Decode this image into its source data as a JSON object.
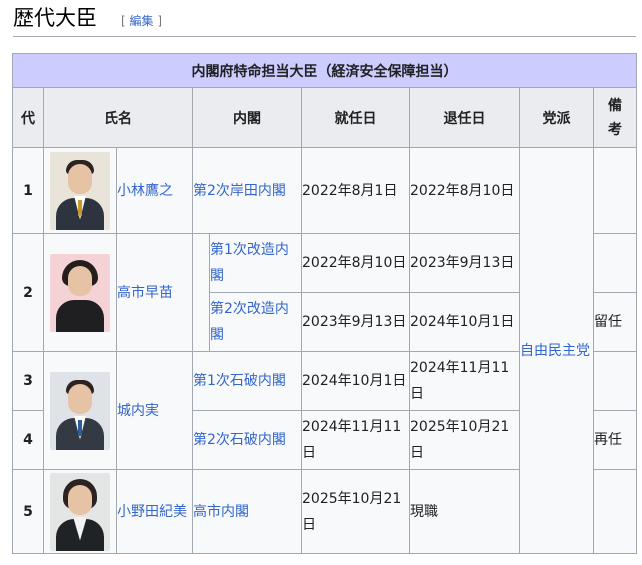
{
  "heading": {
    "title": "歴代大臣",
    "edit_open": "[ ",
    "edit_label": "編集",
    "edit_close": " ]"
  },
  "table": {
    "caption": "内閣府特命担当大臣（経済安全保障担当）",
    "columns": {
      "number": "代",
      "name": "氏名",
      "cabinet": "内閣",
      "start": "就任日",
      "end": "退任日",
      "party": "党派",
      "note_line1": "備",
      "note_line2": "考"
    },
    "party_all": "自由民主党",
    "rows": [
      {
        "number": "1",
        "name": "小林鷹之",
        "cabinet": "第2次岸田内閣",
        "start": "2022年8月1日",
        "end": "2022年8月10日",
        "note": ""
      },
      {
        "number": "2",
        "name": "高市早苗",
        "cabinet_sub1": "第1次改造内閣",
        "start1": "2022年8月10日",
        "end1": "2023年9月13日",
        "note1": "",
        "cabinet_sub2": "第2次改造内閣",
        "start2": "2023年9月13日",
        "end2": "2024年10月1日",
        "note2": "留任"
      },
      {
        "number": "3",
        "name": "城内実",
        "cabinet": "第1次石破内閣",
        "start": "2024年10月1日",
        "end": "2024年11月11日",
        "note": ""
      },
      {
        "number": "4",
        "cabinet": "第2次石破内閣",
        "start": "2024年11月11日",
        "end": "2025年10月21日",
        "note": "再任"
      },
      {
        "number": "5",
        "name": "小野田紀美",
        "cabinet": "高市内閣",
        "start": "2025年10月21日",
        "end": "現職",
        "note": ""
      }
    ]
  }
}
